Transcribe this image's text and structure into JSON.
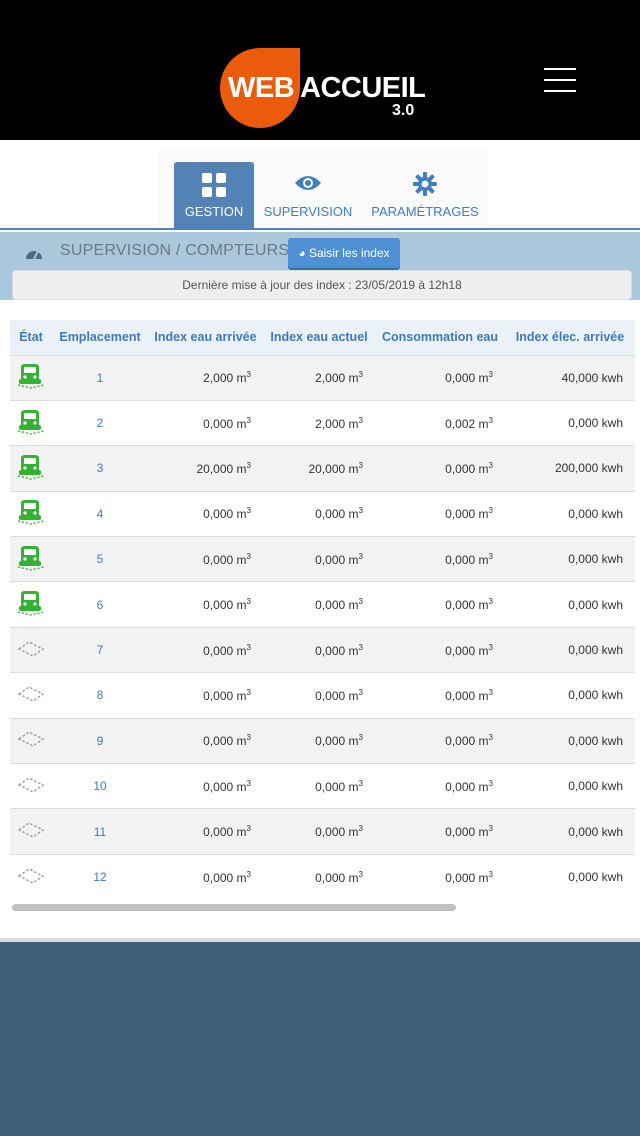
{
  "header": {
    "logo_web": "WEB",
    "logo_accueil": "ACCUEIL",
    "logo_version": "3.0"
  },
  "tabs": [
    {
      "label": "GESTION",
      "icon": "grid-icon",
      "active": true
    },
    {
      "label": "SUPERVISION",
      "icon": "eye-icon",
      "active": false
    },
    {
      "label": "PARAMÉTRAGES",
      "icon": "gear-icon",
      "active": false
    }
  ],
  "subheader": {
    "title": "SUPERVISION / COMPTEURS",
    "saisir_label": "Saisir les index",
    "last_update": "Dernière mise à jour des index : 23/05/2019 à 12h18"
  },
  "table": {
    "headers": [
      "État",
      "Emplacement",
      "Index eau arrivée",
      "Index eau actuel",
      "Consommation eau",
      "Index élec. arrivée"
    ],
    "rows": [
      {
        "occupied": true,
        "emplacement": "1",
        "eau_arrivee": "2,000",
        "eau_actuel": "2,000",
        "conso": "0,000",
        "elec": "40,000 kwh"
      },
      {
        "occupied": true,
        "emplacement": "2",
        "eau_arrivee": "0,000",
        "eau_actuel": "2,000",
        "conso": "0,002",
        "elec": "0,000 kwh"
      },
      {
        "occupied": true,
        "emplacement": "3",
        "eau_arrivee": "20,000",
        "eau_actuel": "20,000",
        "conso": "0,000",
        "elec": "200,000 kwh"
      },
      {
        "occupied": true,
        "emplacement": "4",
        "eau_arrivee": "0,000",
        "eau_actuel": "0,000",
        "conso": "0,000",
        "elec": "0,000 kwh"
      },
      {
        "occupied": true,
        "emplacement": "5",
        "eau_arrivee": "0,000",
        "eau_actuel": "0,000",
        "conso": "0,000",
        "elec": "0,000 kwh"
      },
      {
        "occupied": true,
        "emplacement": "6",
        "eau_arrivee": "0,000",
        "eau_actuel": "0,000",
        "conso": "0,000",
        "elec": "0,000 kwh"
      },
      {
        "occupied": false,
        "emplacement": "7",
        "eau_arrivee": "0,000",
        "eau_actuel": "0,000",
        "conso": "0,000",
        "elec": "0,000 kwh"
      },
      {
        "occupied": false,
        "emplacement": "8",
        "eau_arrivee": "0,000",
        "eau_actuel": "0,000",
        "conso": "0,000",
        "elec": "0,000 kwh"
      },
      {
        "occupied": false,
        "emplacement": "9",
        "eau_arrivee": "0,000",
        "eau_actuel": "0,000",
        "conso": "0,000",
        "elec": "0,000 kwh"
      },
      {
        "occupied": false,
        "emplacement": "10",
        "eau_arrivee": "0,000",
        "eau_actuel": "0,000",
        "conso": "0,000",
        "elec": "0,000 kwh"
      },
      {
        "occupied": false,
        "emplacement": "11",
        "eau_arrivee": "0,000",
        "eau_actuel": "0,000",
        "conso": "0,000",
        "elec": "0,000 kwh"
      },
      {
        "occupied": false,
        "emplacement": "12",
        "eau_arrivee": "0,000",
        "eau_actuel": "0,000",
        "conso": "0,000",
        "elec": "0,000 kwh"
      }
    ],
    "unit_m": "m",
    "unit_exp": "3"
  },
  "colors": {
    "accent": "#5282b6",
    "logo_orange": "#ea5b0c",
    "occupied_green": "#35b234",
    "empty_gray": "#9a9a9a"
  }
}
